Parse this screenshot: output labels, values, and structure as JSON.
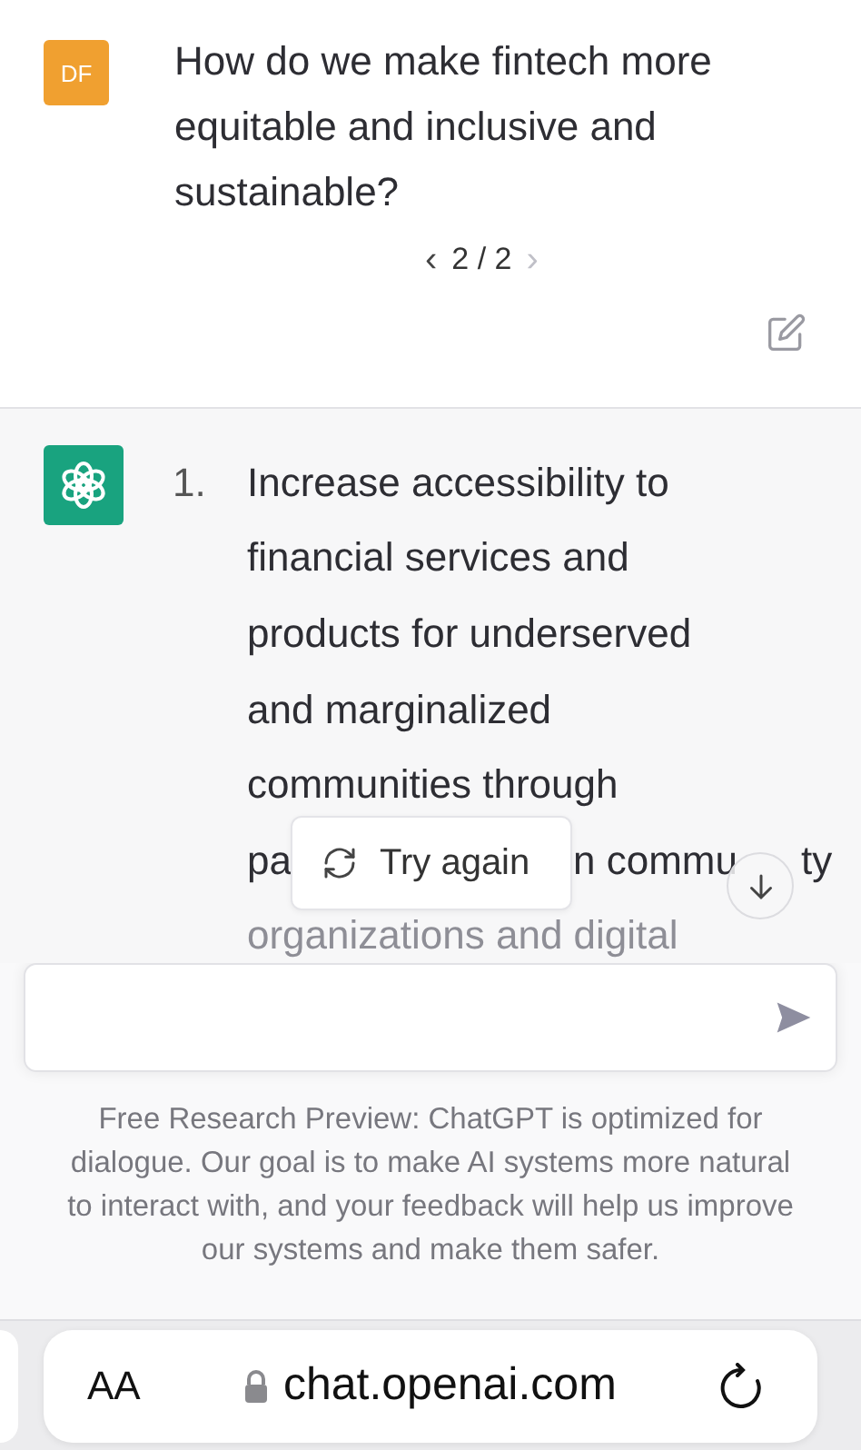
{
  "user_message": {
    "avatar": "DF",
    "text": "How do we make fintech more equitable and inclusive and sustainable?",
    "pager": {
      "prev": "‹",
      "label": "2 / 2",
      "next": "›"
    }
  },
  "assistant_message": {
    "items": [
      {
        "number": "1.",
        "lines": [
          {
            "kind": "text",
            "text": "Increase accessibility to"
          },
          {
            "kind": "text",
            "text": "financial services and"
          },
          {
            "kind": "text",
            "text": "products for underserved"
          },
          {
            "kind": "text",
            "text": "and marginalized"
          },
          {
            "kind": "text",
            "text": "communities through"
          },
          {
            "kind": "fragments",
            "parts": [
              "pa",
              "n commu",
              "ty"
            ]
          },
          {
            "kind": "faded",
            "text": "organizations and digital"
          }
        ]
      }
    ]
  },
  "try_again_button": {
    "label": "Try again"
  },
  "disclaimer": "Free Research Preview: ChatGPT is optimized for dialogue. Our goal is to make AI systems more natural to interact with, and your feedback will help us improve our systems and make them safer.",
  "browser_bar": {
    "text_size": "AA",
    "url": "chat.openai.com"
  }
}
